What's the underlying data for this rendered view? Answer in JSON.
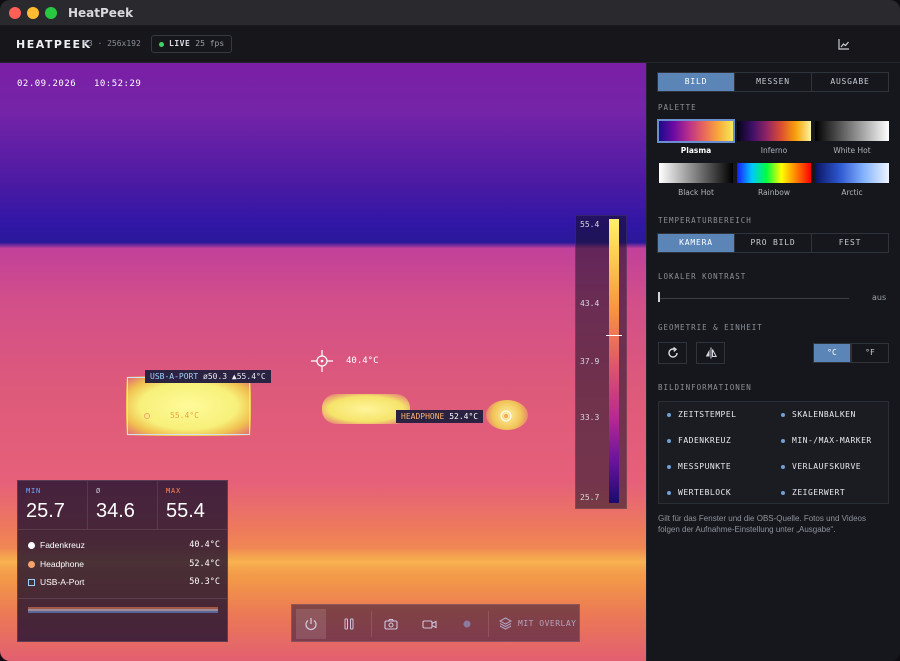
{
  "window": {
    "title": "HeatPeek"
  },
  "toolbar": {
    "brand": "HEATPEEK",
    "device": "P3 · 256x192",
    "live_label": "LIVE",
    "fps": "25 fps"
  },
  "viewer": {
    "timestamp_date": "02.09.2026",
    "timestamp_time": "10:52:29",
    "crosshair_value": "40.4°C",
    "usb_tag_name": "USB-A-PORT",
    "usb_tag_avg": "ø50.3",
    "usb_tag_max": "▲55.4°C",
    "usb_inner_label": "55.4°C",
    "headphone_tag_name": "HEADPHONE",
    "headphone_tag_value": "52.4°C",
    "scale_ticks": [
      "55.4",
      "43.4",
      "37.9",
      "33.3",
      "25.7"
    ],
    "stats": {
      "min_label": "MIN",
      "min_value": "25.7",
      "avg_label": "Ø",
      "avg_value": "34.6",
      "max_label": "MAX",
      "max_value": "55.4",
      "rows": [
        {
          "name": "Fadenkreuz",
          "value": "40.4°C"
        },
        {
          "name": "Headphone",
          "value": "52.4°C"
        },
        {
          "name": "USB-A-Port",
          "value": "50.3°C"
        }
      ]
    },
    "controls": {
      "overlay_label": "MIT OVERLAY"
    },
    "colors": {
      "min": "#6fa8ff",
      "avg": "#c7c3d3",
      "max": "#ff8a5a"
    }
  },
  "panel": {
    "tabs": [
      "BILD",
      "MESSEN",
      "AUSGABE"
    ],
    "palette_title": "PALETTE",
    "palettes": [
      "Plasma",
      "Inferno",
      "White Hot",
      "Black Hot",
      "Rainbow",
      "Arctic"
    ],
    "range_title": "TEMPERATURBEREICH",
    "range_options": [
      "KAMERA",
      "PRO BILD",
      "FEST"
    ],
    "contrast_title": "LOKALER KONTRAST",
    "contrast_value": "aus",
    "geometry_title": "GEOMETRIE & EINHEIT",
    "units": [
      "°C",
      "°F"
    ],
    "info_title": "BILDINFORMATIONEN",
    "info_items": [
      "ZEITSTEMPEL",
      "SKALENBALKEN",
      "FADENKREUZ",
      "MIN-/MAX-MARKER",
      "MESSPUNKTE",
      "VERLAUFSKURVE",
      "WERTEBLOCK",
      "ZEIGERWERT"
    ],
    "note": "Gilt für das Fenster und die OBS-Quelle. Fotos und Videos folgen der Aufnahme-Einstellung unter „Ausgabe“."
  }
}
